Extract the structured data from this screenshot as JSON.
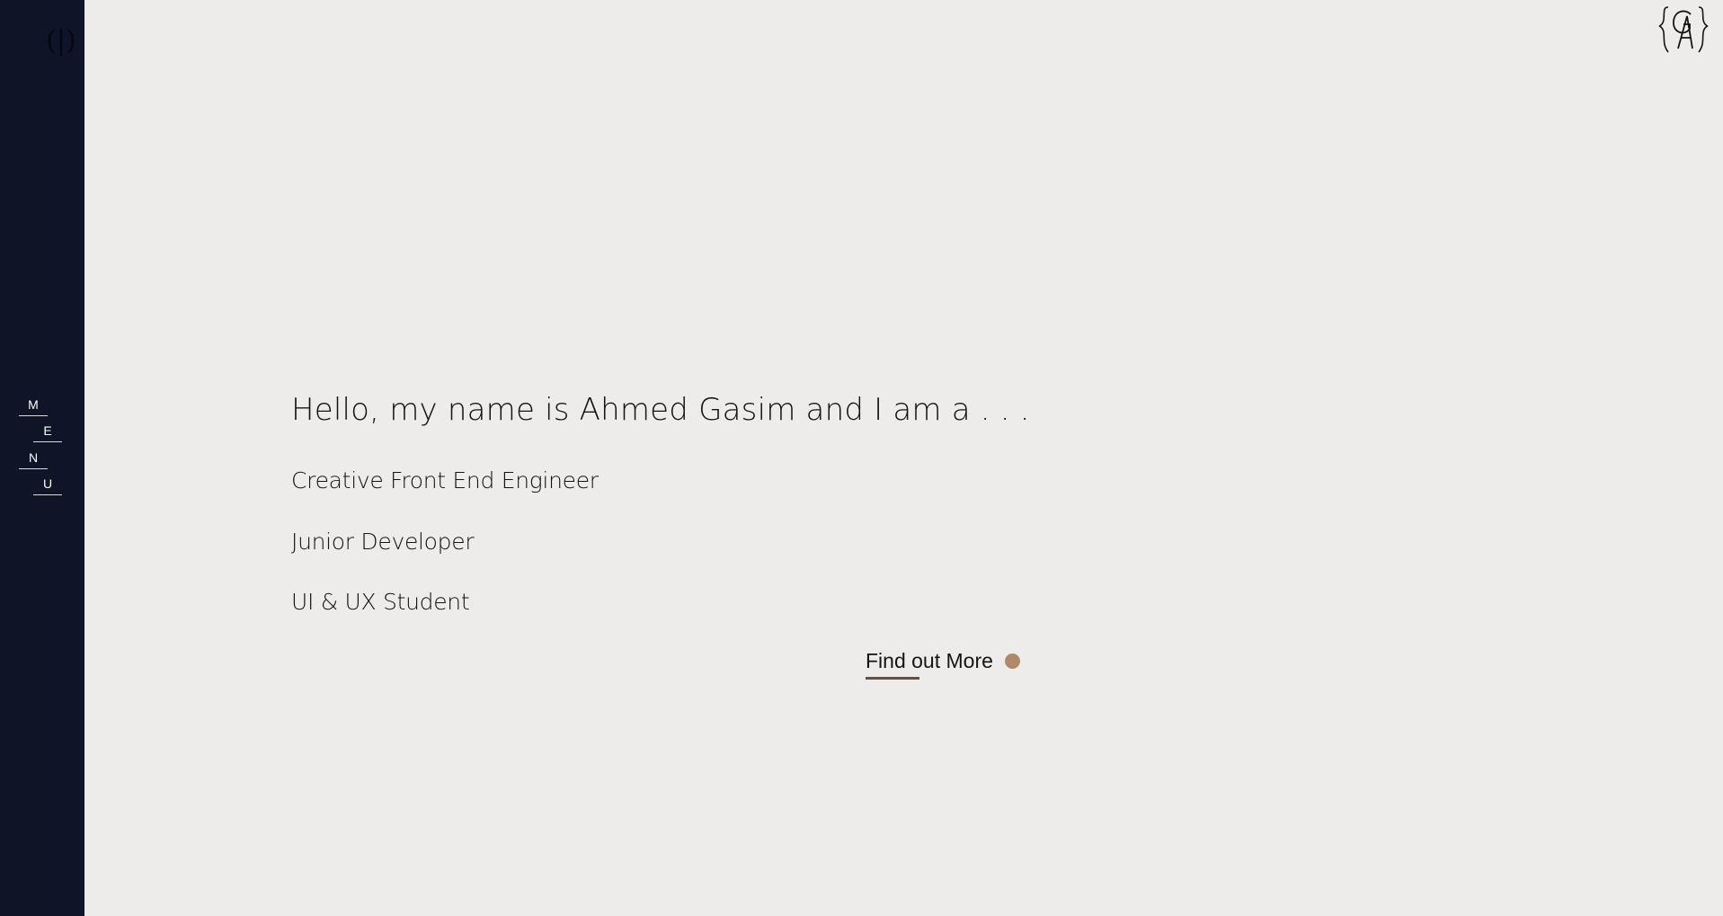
{
  "sidebar": {
    "toggle_symbol": "(|)",
    "menu_letters": [
      "M",
      "E",
      "N",
      "U"
    ]
  },
  "logo": {
    "text": "GA"
  },
  "hero": {
    "title": "Hello, my name is Ahmed Gasim and I am a . . .",
    "roles": [
      "Creative Front End Engineer",
      "Junior Developer",
      "UI & UX Student"
    ]
  },
  "cta": {
    "label": "Find out More"
  },
  "colors": {
    "background": "#edecea",
    "sidebar": "#0f1427",
    "text": "#141414",
    "accent_dot": "#ae896a",
    "accent_underline": "#6b4e33"
  }
}
